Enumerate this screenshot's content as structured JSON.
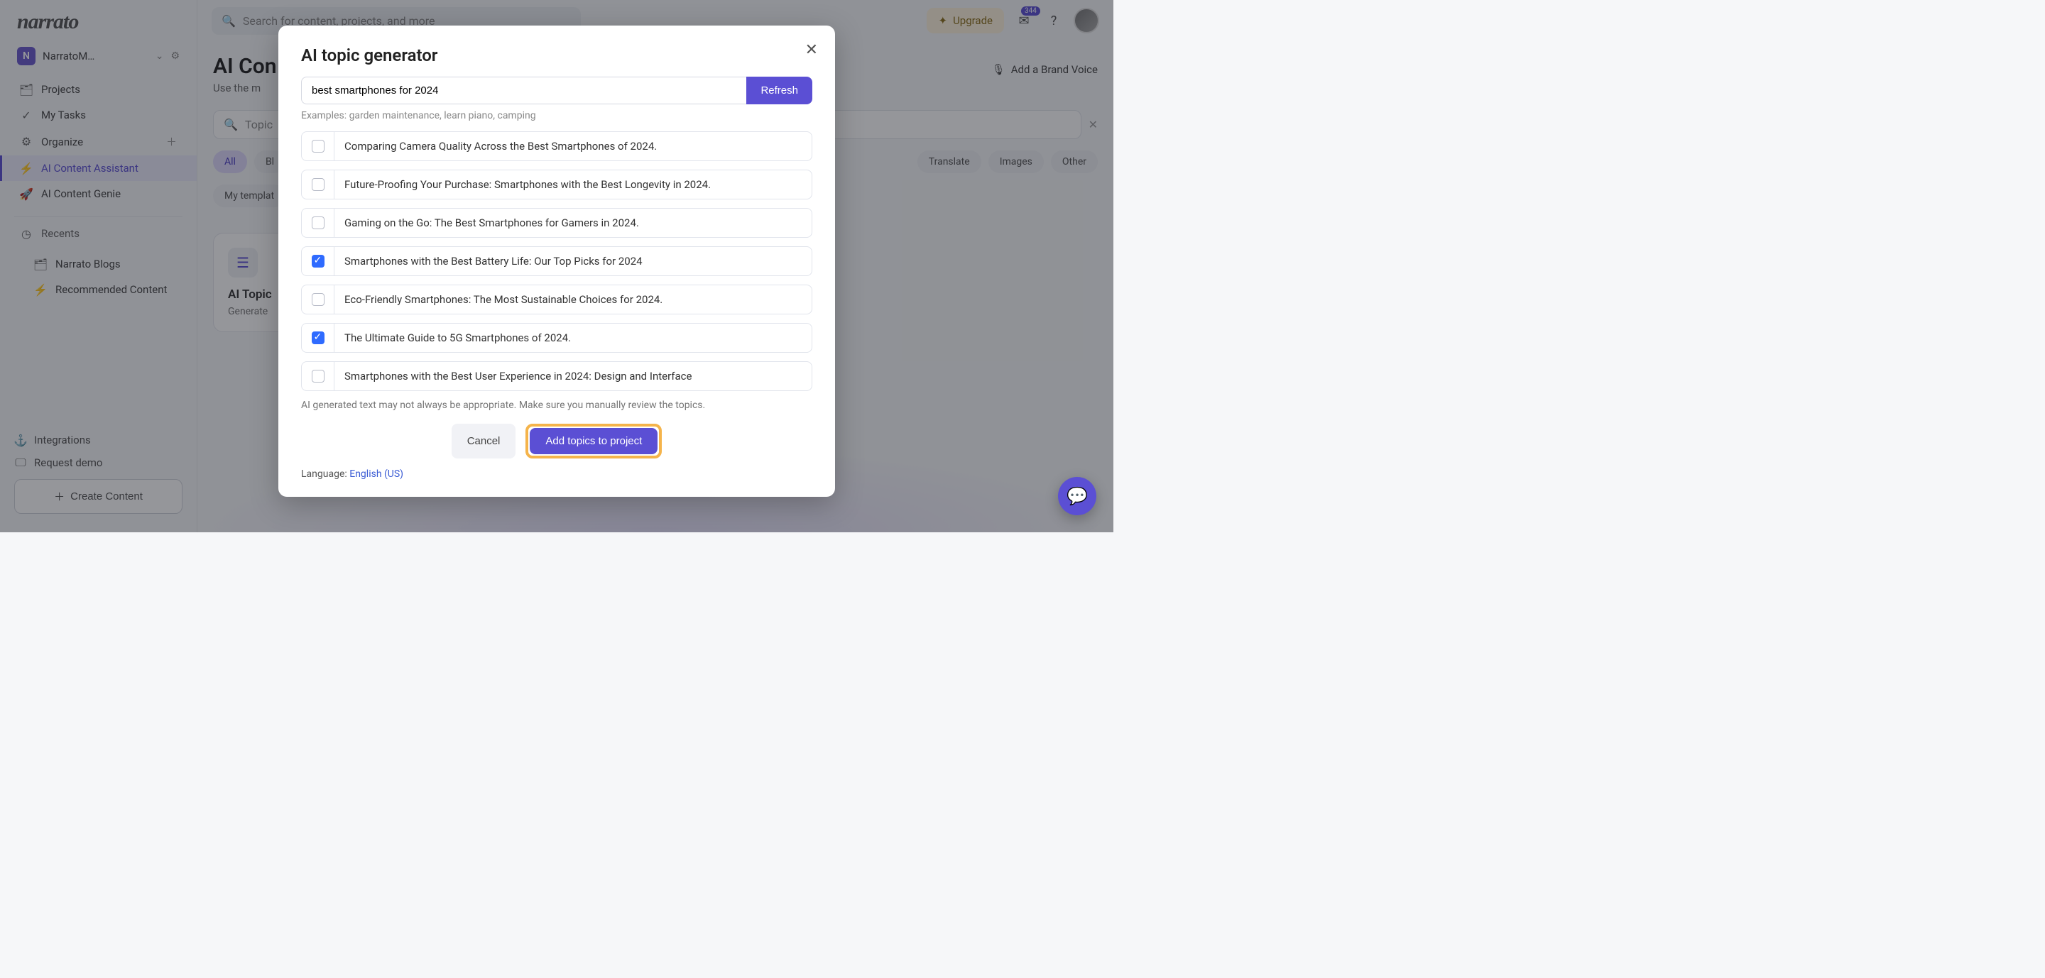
{
  "brand": "narrato",
  "workspace": {
    "badge": "N",
    "name": "NarratoM…"
  },
  "sidebar": {
    "items": [
      {
        "icon": "🗂",
        "label": "Projects"
      },
      {
        "icon": "✓",
        "label": "My Tasks"
      },
      {
        "icon": "⚙",
        "label": "Organize"
      },
      {
        "icon": "⚡",
        "label": "AI Content Assistant",
        "active": true
      },
      {
        "icon": "🚀",
        "label": "AI Content Genie"
      }
    ],
    "recents_label": "Recents",
    "recents": [
      {
        "icon": "🗂",
        "label": "Narrato Blogs"
      },
      {
        "icon": "⚡",
        "label": "Recommended Content"
      }
    ],
    "bottom": {
      "integrations": "Integrations",
      "request_demo": "Request demo",
      "create": "Create Content"
    }
  },
  "topbar": {
    "search_placeholder": "Search for content, projects, and more",
    "upgrade": "Upgrade",
    "notif_count": "344"
  },
  "page": {
    "title_prefix": "AI Con",
    "subtitle_prefix": "Use the m",
    "brand_voice": "Add a Brand Voice",
    "template_search": "Topic",
    "pills": [
      "All",
      "Bl",
      "Translate",
      "Images",
      "Other"
    ],
    "my_templates": "My templat",
    "card": {
      "title": "AI Topic",
      "desc": "Generate"
    }
  },
  "modal": {
    "title": "AI topic generator",
    "input_value": "best smartphones for 2024",
    "refresh": "Refresh",
    "examples": "Examples: garden maintenance, learn piano, camping",
    "topics": [
      {
        "checked": false,
        "text": "Comparing Camera Quality Across the Best Smartphones of 2024."
      },
      {
        "checked": false,
        "text": "Future-Proofing Your Purchase: Smartphones with the Best Longevity in 2024."
      },
      {
        "checked": false,
        "text": "Gaming on the Go: The Best Smartphones for Gamers in 2024."
      },
      {
        "checked": true,
        "text": "Smartphones with the Best Battery Life: Our Top Picks for 2024"
      },
      {
        "checked": false,
        "text": "Eco-Friendly Smartphones: The Most Sustainable Choices for 2024."
      },
      {
        "checked": true,
        "text": "The Ultimate Guide to 5G Smartphones of 2024."
      },
      {
        "checked": false,
        "text": "Smartphones with the Best User Experience in 2024: Design and Interface"
      }
    ],
    "disclaimer": "AI generated text may not always be appropriate. Make sure you manually review the topics.",
    "cancel": "Cancel",
    "add": "Add topics to project",
    "language_label": "Language: ",
    "language_value": "English (US)"
  }
}
